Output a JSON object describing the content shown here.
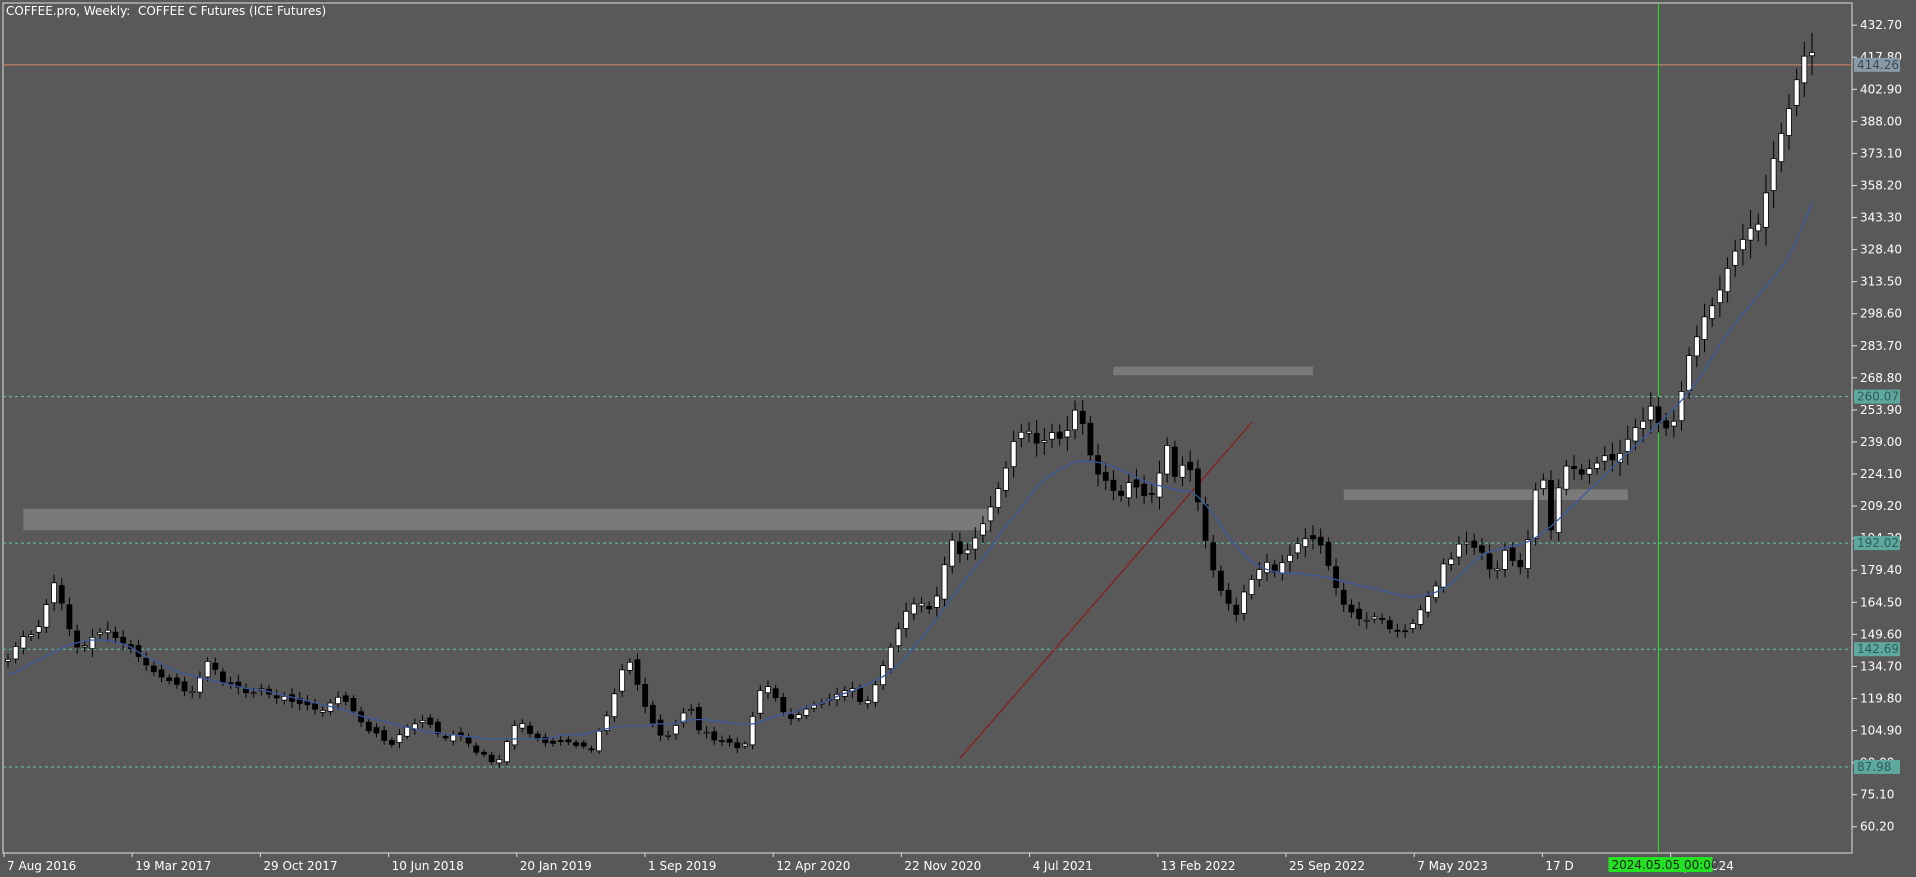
{
  "window": {
    "title": "COFFEE.pro, Weekly:  COFFEE C Futures (ICE Futures)"
  },
  "colors": {
    "background": "#595959",
    "frame": "#e0e0e0",
    "candle": "#000000",
    "moving_average": "#3a5a9f",
    "trendline": "#8b1a1a",
    "current_price_line": "#d9866f",
    "level_line": "#5fc6b7",
    "vertical_marker": "#22e222",
    "zone": "#7a7a7a"
  },
  "chart_data": {
    "type": "candlestick",
    "title": "COFFEE.pro, Weekly:  COFFEE C Futures (ICE Futures)",
    "ylim": [
      48,
      443
    ],
    "y_ticks": [
      "432.70",
      "417.80",
      "402.90",
      "388.00",
      "373.10",
      "358.20",
      "343.30",
      "328.40",
      "313.50",
      "298.60",
      "283.70",
      "268.80",
      "253.90",
      "239.00",
      "224.10",
      "209.20",
      "194.30",
      "179.40",
      "164.50",
      "149.60",
      "134.70",
      "119.80",
      "104.90",
      "90.00",
      "75.10",
      "60.20"
    ],
    "x_labels": [
      "7 Aug 2016",
      "19 Mar 2017",
      "29 Oct 2017",
      "10 Jun 2018",
      "20 Jan 2019",
      "1 Sep 2019",
      "12 Apr 2020",
      "22 Nov 2020",
      "4 Jul 2021",
      "13 Feb 2022",
      "25 Sep 2022",
      "7 May 2023",
      "17 D",
      "8 Jul 2024"
    ],
    "series": [
      {
        "name": "price",
        "values": [
          138,
          145,
          150,
          149,
          159,
          175,
          164,
          150,
          141,
          147,
          150,
          152,
          148,
          145,
          142,
          137,
          133,
          130,
          128,
          126,
          122,
          124,
          138,
          134,
          127,
          127,
          124,
          121,
          125,
          122,
          120,
          121,
          117,
          118,
          115,
          114,
          118,
          121,
          117,
          111,
          105,
          104,
          100,
          98,
          106,
          107,
          110,
          108,
          103,
          101,
          104,
          101,
          95,
          94,
          90,
          92,
          105,
          110,
          104,
          101,
          99,
          99,
          101,
          98,
          98,
          96,
          106,
          114,
          128,
          140,
          128,
          116,
          107,
          101,
          104,
          112,
          116,
          105,
          104,
          99,
          101,
          97,
          97,
          112,
          126,
          125,
          116,
          110,
          112,
          115,
          117,
          118,
          121,
          123,
          125,
          118,
          119,
          130,
          140,
          150,
          160,
          164,
          164,
          160,
          175,
          195,
          187,
          189,
          196,
          204,
          214,
          224,
          239,
          244,
          244,
          235,
          245,
          240,
          244,
          255,
          245,
          225,
          223,
          217,
          214,
          221,
          217,
          212,
          218,
          240,
          223,
          229,
          225,
          201,
          183,
          171,
          164,
          158,
          174,
          176,
          185,
          178,
          183,
          187,
          194,
          194,
          194,
          183,
          171,
          162,
          159,
          155,
          158,
          157,
          152,
          151,
          151,
          158,
          166,
          171,
          183,
          185,
          195,
          190,
          190,
          180,
          180,
          191,
          180,
          182,
          215,
          223,
          196,
          224,
          230,
          223,
          226,
          229,
          233,
          230,
          236,
          245,
          247,
          256,
          247,
          245,
          251,
          276,
          286,
          297,
          303,
          312,
          325,
          331,
          338,
          340,
          357,
          376,
          387,
          403,
          418,
          420
        ]
      },
      {
        "name": "moving_average",
        "values": [
          131,
          132,
          135,
          137,
          139,
          141,
          143,
          145,
          146,
          147,
          147,
          147,
          146,
          145,
          143,
          140,
          138,
          136,
          134,
          132,
          131,
          130,
          129,
          128,
          127,
          126,
          125,
          124,
          124,
          123,
          122,
          121,
          120,
          119,
          118,
          117,
          116,
          115,
          114,
          112,
          111,
          110,
          109,
          108,
          107,
          106,
          105,
          104,
          104,
          103,
          103,
          102,
          102,
          101,
          101,
          101,
          101,
          101,
          101,
          101,
          101,
          102,
          103,
          103,
          103,
          104,
          105,
          106,
          107,
          107,
          107,
          107,
          108,
          108,
          108,
          109,
          110,
          110,
          110,
          109,
          109,
          108,
          108,
          108,
          109,
          111,
          112,
          113,
          114,
          116,
          117,
          118,
          120,
          122,
          123,
          125,
          127,
          129,
          131,
          135,
          139,
          144,
          149,
          154,
          160,
          166,
          171,
          177,
          182,
          187,
          193,
          199,
          204,
          209,
          215,
          220,
          223,
          226,
          228,
          230,
          230,
          230,
          229,
          228,
          226,
          224,
          222,
          220,
          219,
          218,
          217,
          216,
          216,
          212,
          207,
          201,
          195,
          190,
          185,
          182,
          180,
          179,
          178,
          178,
          178,
          177,
          177,
          176,
          175,
          174,
          173,
          172,
          171,
          170,
          169,
          168,
          167,
          167,
          168,
          169,
          171,
          174,
          178,
          182,
          186,
          188,
          189,
          190,
          191,
          192,
          194,
          197,
          200,
          204,
          208,
          212,
          216,
          220,
          224,
          228,
          232,
          236,
          240,
          244,
          248,
          252,
          256,
          261,
          266,
          272,
          279,
          286,
          292,
          297,
          302,
          307,
          312,
          317,
          322,
          330,
          340,
          350
        ]
      }
    ],
    "price_lines": [
      {
        "label": "414.26",
        "value": 414.26,
        "kind": "current"
      },
      {
        "label": "260.07",
        "value": 260.07,
        "kind": "level"
      },
      {
        "label": "192.02",
        "value": 192.02,
        "kind": "level"
      },
      {
        "label": "142.69",
        "value": 142.69,
        "kind": "level"
      },
      {
        "label": "87.98",
        "value": 87.98,
        "kind": "level"
      }
    ],
    "zones": [
      {
        "from_index": 2,
        "to_index": 128,
        "low": 198,
        "high": 208
      },
      {
        "from_index": 144,
        "to_index": 170,
        "low": 270,
        "high": 274
      },
      {
        "from_index": 174,
        "to_index": 211,
        "low": 212,
        "high": 217
      }
    ],
    "trendline": {
      "from_index": 124,
      "to_index": 162,
      "from_value": 92,
      "to_value": 248
    },
    "vertical_marker": {
      "index": 215,
      "label": "2024.05.05 00:00"
    },
    "total_bars": 236
  }
}
